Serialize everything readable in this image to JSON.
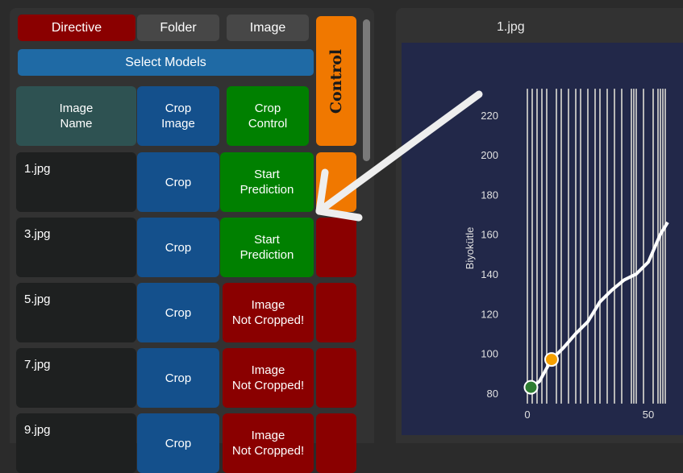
{
  "toolbar": {
    "directive": "Directive",
    "folder": "Folder",
    "image": "Image",
    "select_models": "Select Models",
    "control": "Control"
  },
  "table": {
    "headers": {
      "image_name": "Image\nName",
      "crop_image": "Crop\nImage",
      "crop_control": "Crop\nControl"
    },
    "rows": [
      {
        "name": "1.jpg",
        "crop": "Crop",
        "status": "Start\nPrediction",
        "status_color": "#008000",
        "control_color": "#f07800"
      },
      {
        "name": "3.jpg",
        "crop": "Crop",
        "status": "Start\nPrediction",
        "status_color": "#008000",
        "control_color": "#8a0000"
      },
      {
        "name": "5.jpg",
        "crop": "Crop",
        "status": "Image\nNot Cropped!",
        "status_color": "#8a0000",
        "control_color": "#8a0000"
      },
      {
        "name": "7.jpg",
        "crop": "Crop",
        "status": "Image\nNot Cropped!",
        "status_color": "#8a0000",
        "control_color": "#8a0000"
      },
      {
        "name": "9.jpg",
        "crop": "Crop",
        "status": "Image\nNot Cropped!",
        "status_color": "#8a0000",
        "control_color": "#8a0000"
      }
    ]
  },
  "viewer": {
    "title": "1.jpg"
  },
  "chart_data": {
    "type": "line",
    "title": "",
    "xlabel": "",
    "ylabel": "Biyokütle",
    "xlim": [
      -3,
      58
    ],
    "ylim": [
      76,
      232
    ],
    "yticks": [
      80,
      100,
      120,
      140,
      160,
      180,
      200,
      220
    ],
    "xticks": [
      0,
      50
    ],
    "vlines_x": [
      0,
      2,
      4,
      6,
      8,
      12,
      14,
      17,
      20,
      22,
      25,
      28,
      30,
      33,
      36,
      39,
      43,
      44,
      45,
      48,
      52,
      54,
      55,
      56,
      57
    ],
    "series": [
      {
        "color": "#ffffff",
        "x": [
          1.5,
          5,
          10,
          15,
          20,
          25,
          30,
          35,
          40,
          45,
          50,
          55,
          58
        ],
        "y": [
          83,
          86,
          97,
          103,
          110,
          116,
          126,
          132,
          137,
          140,
          146,
          160,
          166
        ]
      }
    ],
    "markers": [
      {
        "x": 1.5,
        "y": 83,
        "color": "#2e7d32"
      },
      {
        "x": 10,
        "y": 97,
        "color": "#f5a000"
      }
    ],
    "annotation_arrow": {
      "from": "top-right",
      "to": "row-1-control",
      "color": "#eeeeee"
    }
  }
}
